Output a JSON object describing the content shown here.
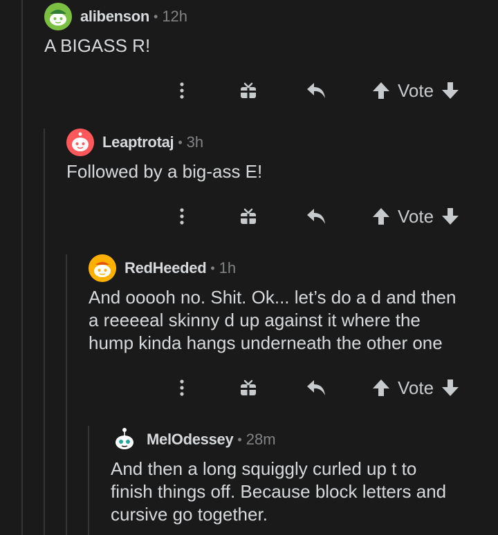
{
  "comments": [
    {
      "author": "alibenson",
      "time": "12h",
      "body": "A BIGASS R!",
      "avatar": {
        "icon": "snoo-avatar",
        "color": "#7bc043"
      },
      "vote_label": "Vote"
    },
    {
      "author": "Leaptrotaj",
      "time": "3h",
      "body": "Followed by a big-ass E!",
      "avatar": {
        "icon": "snoo-avatar",
        "color": "#ff585b"
      },
      "vote_label": "Vote"
    },
    {
      "author": "RedHeeded",
      "time": "1h",
      "body": "And ooooh no. Shit. Ok... let’s do a d and then\na reeeeal skinny d up against it where the\nhump kinda hangs underneath the other one",
      "avatar": {
        "icon": "snoo-avatar",
        "color": "#ffb000"
      },
      "vote_label": "Vote"
    },
    {
      "author": "MelOdessey",
      "time": "28m",
      "body": "And then a long squiggly curled up t to\nfinish things off. Because block letters and\ncursive go together.",
      "avatar": {
        "icon": "snoo-avatar",
        "color": "#ffffff"
      }
    }
  ],
  "separator": "•",
  "icons": {
    "more": "more-vertical-icon",
    "award": "gift-award-icon",
    "reply": "reply-arrow-icon",
    "upvote": "upvote-arrow-icon",
    "downvote": "downvote-arrow-icon"
  }
}
